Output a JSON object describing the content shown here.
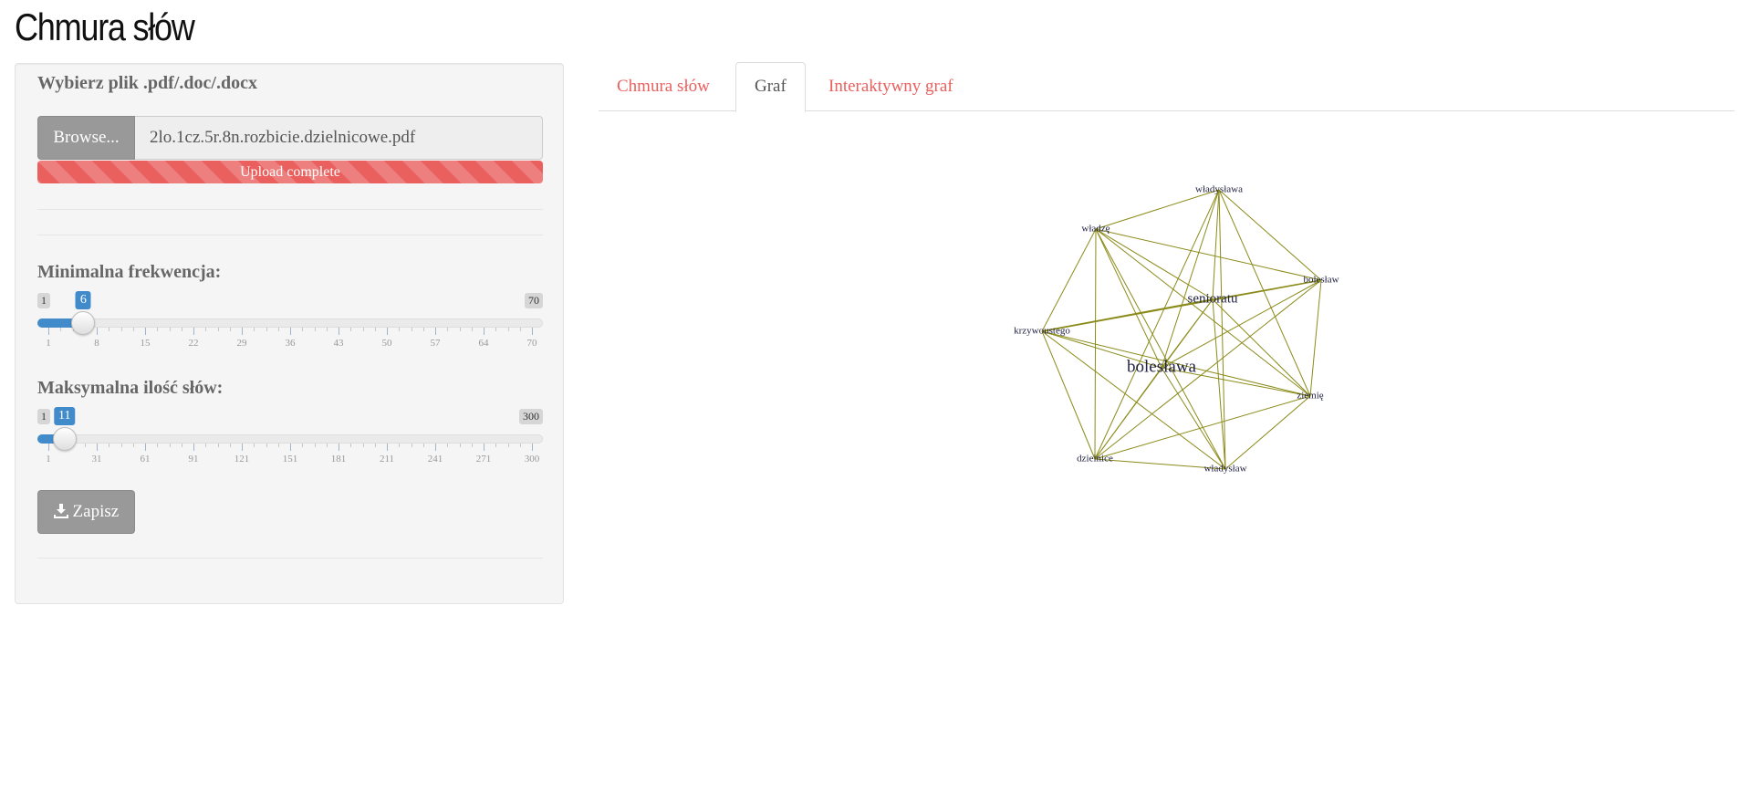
{
  "app": {
    "title": "Chmura słów"
  },
  "sidebar": {
    "file_label": "Wybierz plik .pdf/.doc/.docx",
    "browse_label": "Browse...",
    "file_name": "2lo.1cz.5r.8n.rozbicie.dzielnicowe.pdf",
    "upload_status": "Upload complete",
    "min_freq": {
      "label": "Minimalna frekwencja:",
      "min": 1,
      "max": 70,
      "value": 6,
      "min_text": "1",
      "max_text": "70",
      "value_text": "6",
      "ticks": [
        "1",
        "8",
        "15",
        "22",
        "29",
        "36",
        "43",
        "50",
        "57",
        "64",
        "70"
      ]
    },
    "max_words": {
      "label": "Maksymalna ilość słów:",
      "min": 1,
      "max": 300,
      "value": 11,
      "min_text": "1",
      "max_text": "300",
      "value_text": "11",
      "ticks": [
        "1",
        "31",
        "61",
        "91",
        "121",
        "151",
        "181",
        "211",
        "241",
        "271",
        "300"
      ]
    },
    "save_label": "Zapisz"
  },
  "tabs": [
    {
      "label": "Chmura słów",
      "active": false
    },
    {
      "label": "Graf",
      "active": true
    },
    {
      "label": "Interaktywny graf",
      "active": false
    }
  ],
  "graph": {
    "edge_color": "#8b8b1a",
    "nodes": [
      {
        "id": "wladyslawa",
        "label": "władysława",
        "size": "small"
      },
      {
        "id": "wladze",
        "label": "władzę",
        "size": "small"
      },
      {
        "id": "boleslaw",
        "label": "bolesław",
        "size": "small"
      },
      {
        "id": "senioratu",
        "label": "senioratu",
        "size": "medium"
      },
      {
        "id": "krzywoustego",
        "label": "krzywoustego",
        "size": "small"
      },
      {
        "id": "boleslawa",
        "label": "bolesława",
        "size": "large"
      },
      {
        "id": "ziemie",
        "label": "ziemię",
        "size": "small"
      },
      {
        "id": "dzielnice",
        "label": "dzielnice",
        "size": "small"
      },
      {
        "id": "wladyslaw",
        "label": "władysław",
        "size": "small"
      }
    ]
  },
  "colors": {
    "accent": "#e9605e",
    "slider_blue": "#428bca",
    "button_gray": "#999999"
  }
}
